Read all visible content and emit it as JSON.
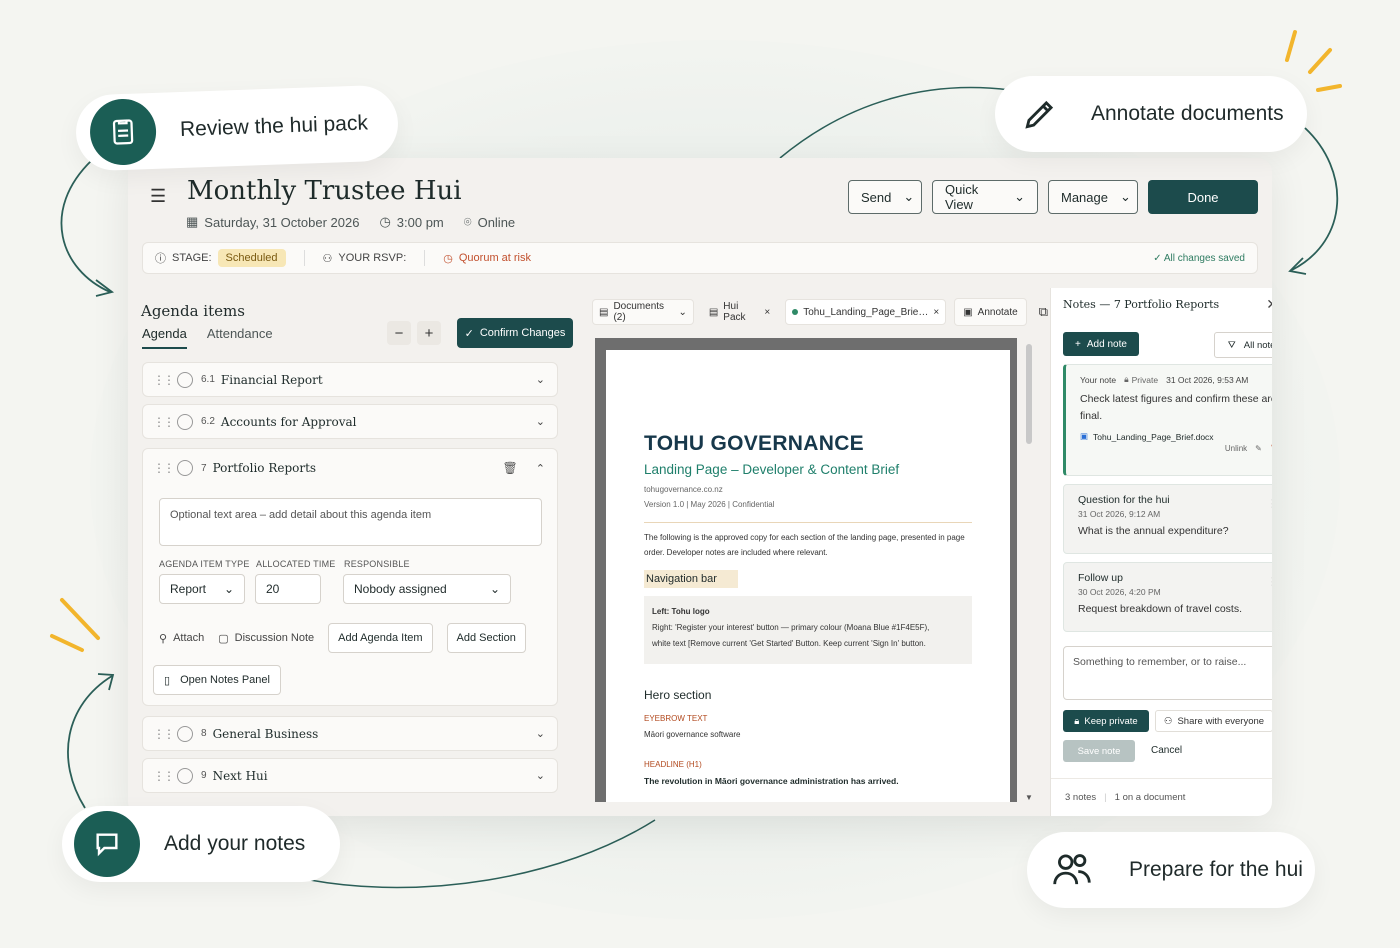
{
  "callouts": {
    "review": "Review the hui pack",
    "annotate": "Annotate documents",
    "add_notes": "Add your notes",
    "prepare": "Prepare for the hui"
  },
  "header": {
    "title": "Monthly Trustee Hui",
    "date": "Saturday, 31 October 2026",
    "time": "3:00 pm",
    "location": "Online",
    "buttons": {
      "send": "Send",
      "quick_view": "Quick View",
      "manage": "Manage",
      "done": "Done"
    }
  },
  "stage_bar": {
    "stage_label": "STAGE:",
    "stage_value": "Scheduled",
    "rsvp_label": "YOUR RSVP:",
    "quorum": "Quorum at risk",
    "saved": "All changes saved"
  },
  "agenda": {
    "title": "Agenda items",
    "tabs": [
      "Agenda",
      "Attendance"
    ],
    "minus": "−",
    "plus": "+",
    "confirm": "Confirm Changes",
    "items": [
      {
        "num": "6.1",
        "name": "Financial Report"
      },
      {
        "num": "6.2",
        "name": "Accounts for Approval"
      },
      {
        "num": "7",
        "name": "Portfolio Reports"
      },
      {
        "num": "8",
        "name": "General Business"
      },
      {
        "num": "9",
        "name": "Next Hui"
      }
    ],
    "expanded": {
      "placeholder": "Optional text area – add detail about this agenda item",
      "labels": {
        "type": "AGENDA ITEM TYPE",
        "time": "ALLOCATED TIME",
        "responsible": "RESPONSIBLE"
      },
      "type_value": "Report",
      "time_value": "20",
      "responsible_value": "Nobody assigned",
      "attach": "Attach",
      "discussion_note": "Discussion Note",
      "add_agenda_item": "Add Agenda Item",
      "add_section": "Add Section",
      "open_notes": "Open Notes Panel"
    }
  },
  "documents": {
    "tabs": {
      "documents": "Documents (2)",
      "hui_pack": "Hui Pack",
      "file": "Tohu_Landing_Page_Brie…",
      "annotate": "Annotate"
    },
    "page": {
      "h1": "TOHU GOVERNANCE",
      "h2": "Landing Page – Developer & Content Brief",
      "site": "tohugovernance.co.nz",
      "version": "Version 1.0  |  May 2026  |  Confidential",
      "intro_1": "The following is the approved copy for each section of the landing page, presented in page",
      "intro_2": "order. Developer notes are included where relevant.",
      "nav_heading": "Navigation bar",
      "nav_left": "Left: Tohu logo",
      "nav_right_1": "Right: 'Register your interest' button — primary colour (Moana Blue #1F4E5F),",
      "nav_right_2": "white text [Remove current 'Get Started' Button. Keep current 'Sign In' button.",
      "hero_heading": "Hero section",
      "eyebrow_label": "EYEBROW TEXT",
      "eyebrow_value": "Māori governance software",
      "headline_label": "HEADLINE (H1)",
      "headline_value": "The revolution in Māori governance administration has arrived."
    }
  },
  "notes": {
    "title": "Notes — 7 Portfolio Reports",
    "add_note": "Add note",
    "all_notes": "All notes",
    "cards": [
      {
        "author": "Your note",
        "privacy": "Private",
        "time": "31 Oct 2026, 9:53 AM",
        "text": "Check latest figures and confirm these are final.",
        "attachment": "Tohu_Landing_Page_Brief.docx",
        "unlink": "Unlink"
      },
      {
        "title": "Question for the hui",
        "time": "31 Oct 2026, 9:12 AM",
        "text": "What is the annual expenditure?"
      },
      {
        "title": "Follow up",
        "time": "30 Oct 2026, 4:20 PM",
        "text": "Request breakdown of travel costs."
      }
    ],
    "placeholder": "Something to remember, or to raise...",
    "keep_private": "Keep private",
    "share": "Share with everyone",
    "save": "Save note",
    "cancel": "Cancel",
    "footer_count": "3 notes",
    "footer_doc": "1 on a document"
  },
  "colors": {
    "primary": "#1c4b4c",
    "accent_green": "#1b5e55",
    "stage_badge": "#f7e7b6",
    "quorum": "#c2502e",
    "doc_blue": "#17384b",
    "doc_teal": "#1f7f6b",
    "yellow_accent": "#f2b52c"
  }
}
